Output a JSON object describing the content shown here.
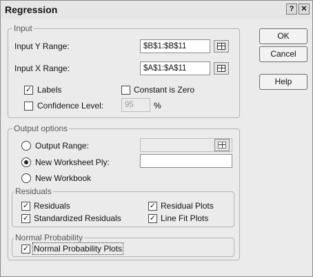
{
  "dialog": {
    "title": "Regression",
    "help_title_icon": "?",
    "close_title_icon": "✕"
  },
  "input": {
    "legend": "Input",
    "y_range_label": "Input Y Range:",
    "y_range_value": "$B$1:$B$11",
    "x_range_label": "Input X Range:",
    "x_range_value": "$A$1:$A$11",
    "labels_label": "Labels",
    "labels_checked": "✓",
    "constant_zero_label": "Constant is Zero",
    "constant_zero_checked": "",
    "confidence_label": "Confidence Level:",
    "confidence_checked": "",
    "confidence_value": "95",
    "percent": "%"
  },
  "output": {
    "legend": "Output options",
    "output_range_label": "Output Range:",
    "output_range_value": "",
    "new_worksheet_label": "New Worksheet Ply:",
    "new_worksheet_value": "",
    "new_workbook_label": "New Workbook",
    "selected": "new_worksheet"
  },
  "residuals": {
    "legend": "Residuals",
    "residuals_label": "Residuals",
    "residuals_checked": "✓",
    "standardized_label": "Standardized Residuals",
    "standardized_checked": "✓",
    "residual_plots_label": "Residual Plots",
    "residual_plots_checked": "✓",
    "line_fit_label": "Line Fit Plots",
    "line_fit_checked": "✓"
  },
  "normal_probability": {
    "legend": "Normal Probability",
    "plots_label": "Normal Probability Plots",
    "plots_checked": "✓"
  },
  "buttons": {
    "ok": "OK",
    "cancel": "Cancel",
    "help": "Help"
  }
}
